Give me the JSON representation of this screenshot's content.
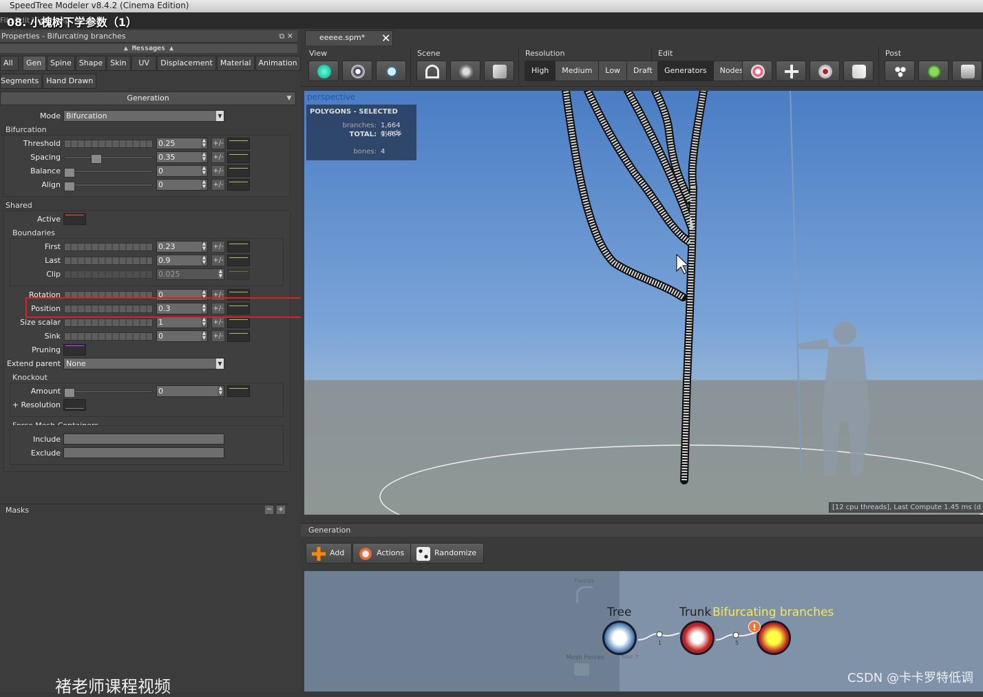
{
  "window": {
    "title": "SpeedTree Modeler v8.4.2 (Cinema Edition)",
    "menu_partial": "File  Edit  View  Help"
  },
  "video_title": "08. 小槐树下学参数（1）",
  "properties": {
    "title": "Properties - Bifurcating branches",
    "messages_label": "Messages",
    "tabs_row1": [
      "All",
      "Gen",
      "Spine",
      "Shape",
      "Skin",
      "UV",
      "Displacement",
      "Material",
      "Animation"
    ],
    "tabs_row2": [
      "Segments",
      "Hand Drawn"
    ],
    "section": "Generation",
    "mode_label": "Mode",
    "mode_value": "Bifurcation",
    "bifurcation_label": "Bifurcation",
    "threshold": {
      "label": "Threshold",
      "value": "0.25"
    },
    "spacing": {
      "label": "Spacing",
      "value": "0.35"
    },
    "balance": {
      "label": "Balance",
      "value": "0"
    },
    "align": {
      "label": "Align",
      "value": "0"
    },
    "shared_label": "Shared",
    "active_label": "Active",
    "boundaries_label": "Boundaries",
    "first": {
      "label": "First",
      "value": "0.23"
    },
    "last": {
      "label": "Last",
      "value": "0.9"
    },
    "clip": {
      "label": "Clip",
      "value": "0.025"
    },
    "rotation": {
      "label": "Rotation",
      "value": "0"
    },
    "position": {
      "label": "Position",
      "value": "0.3"
    },
    "size_scalar": {
      "label": "Size scalar",
      "value": "1"
    },
    "sink": {
      "label": "Sink",
      "value": "0"
    },
    "pruning_label": "Pruning",
    "extend_parent_label": "Extend parent",
    "extend_parent_value": "None",
    "knockout_label": "Knockout",
    "amount": {
      "label": "Amount",
      "value": "0"
    },
    "resolution_label": "+ Resolution",
    "force_mesh_label": "Force Mesh Containers",
    "include_label": "Include",
    "exclude_label": "Exclude",
    "masks_label": "Masks",
    "plusminus": "+/-"
  },
  "document_tab": "eeeee.spm*",
  "toolbar": {
    "view_label": "View",
    "scene_label": "Scene",
    "resolution_label": "Resolution",
    "resolution_options": [
      "High",
      "Medium",
      "Low",
      "Draft"
    ],
    "resolution_selected": "High",
    "edit_label": "Edit",
    "edit_options": [
      "Generators",
      "Nodes"
    ],
    "edit_selected": "Generators",
    "post_label": "Post"
  },
  "viewport": {
    "label": "perspective",
    "stats_title": "POLYGONS - SELECTED",
    "branches_label": "branches:",
    "branches_value": "1,664 quads",
    "total_label": "TOTAL:",
    "total_value": "1,664",
    "bones_label": "bones:",
    "bones_value": "4",
    "cpu_text": "[12 cpu threads], Last Compute 1.45 ms (d"
  },
  "generation_panel": {
    "title": "Generation",
    "add": "Add",
    "actions": "Actions",
    "randomize": "Randomize",
    "forces_label": "Forces",
    "mesh_forces_label": "Mesh Forces",
    "total_label": "Total: 7",
    "node_tree": "Tree",
    "node_trunk": "Trunk",
    "node_branches": "Bifurcating branches",
    "link1": "1",
    "link2": "5"
  },
  "overlays": {
    "watermark_left": "褚老师课程视频",
    "watermark_right": "CSDN @卡卡罗特低调"
  },
  "colors": {
    "highlight": "#e02020",
    "sky": "#6b98d4",
    "selected_node_label": "#f5e85a"
  }
}
